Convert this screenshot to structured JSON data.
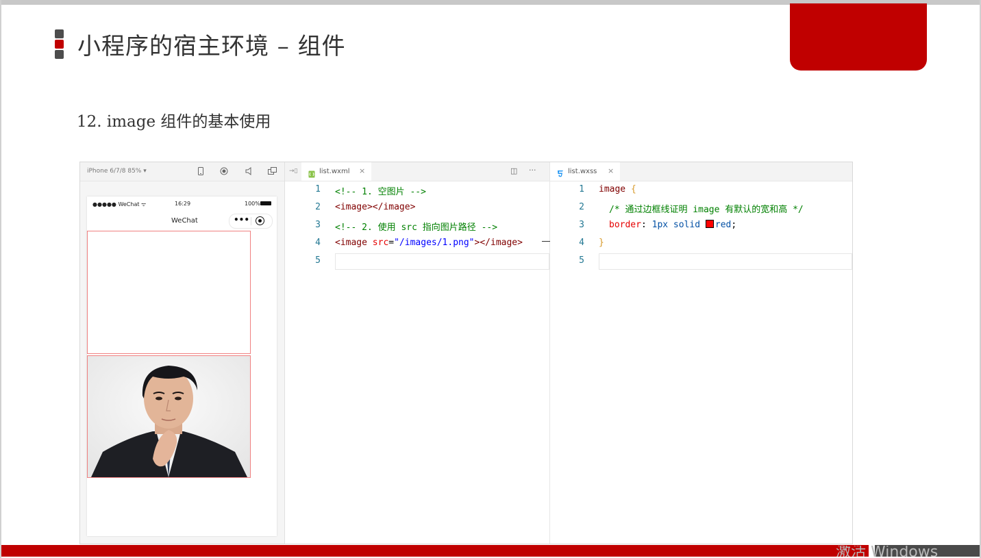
{
  "slide": {
    "title": "小程序的宿主环境 – 组件",
    "section_heading": "12. image 组件的基本使用",
    "watermark": "激活 Windows",
    "accent_color": "#c00000"
  },
  "simulator": {
    "device_label": "iPhone 6/7/8 85% ▾",
    "toolbar_icons": [
      "phone-icon",
      "record-icon",
      "volume-icon",
      "popout-icon"
    ],
    "status_carrier": "●●●●● WeChat ᯤ",
    "status_time": "16:29",
    "status_battery": "100%",
    "nav_title": "WeChat",
    "capsule_more": "•••"
  },
  "wxml_editor": {
    "tab_label": "list.wxml",
    "close_glyph": "×",
    "split_glyph": "◫",
    "more_glyph": "···",
    "line_numbers": [
      "1",
      "2",
      "3",
      "4",
      "5"
    ],
    "lines": [
      {
        "comment": "<!-- 1. 空图片 -->"
      },
      {
        "open": "<image>",
        "close": "</image>"
      },
      {
        "comment": "<!-- 2. 使用 src 指向图片路径 -->"
      },
      {
        "open_start": "<image ",
        "attr": "src",
        "eq": "=",
        "str": "\"/images/1.png\"",
        "open_end": ">",
        "close": "</image>"
      },
      {}
    ]
  },
  "wxss_editor": {
    "tab_label": "list.wxss",
    "close_glyph": "×",
    "line_numbers": [
      "1",
      "2",
      "3",
      "4",
      "5"
    ],
    "lines": [
      {
        "selector": "image",
        "brace": " {"
      },
      {
        "comment": "/* 通过边框线证明 image 有默认的宽和高 */"
      },
      {
        "prop": "border",
        "colon": ": ",
        "val": "1px solid ",
        "color_value": "red",
        "semi": ";"
      },
      {
        "brace": "}"
      },
      {}
    ],
    "swatch_color": "#ff0000"
  }
}
